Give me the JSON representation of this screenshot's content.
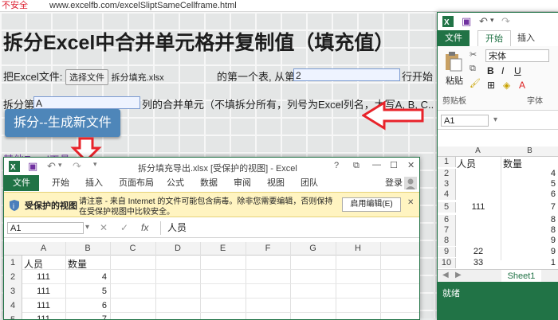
{
  "browser": {
    "security_warning": "不安全",
    "url": "www.excelfb.com/excelSliptSameCellframe.html"
  },
  "page": {
    "title": "拆分Excel中合并单元格并复制值（填充值）",
    "row1": {
      "prefix": "把Excel文件:",
      "choose_file_button": "选择文件",
      "file_name": "拆分填充.xlsx",
      "middle": "的第一个表, 从第",
      "start_row_value": "2",
      "suffix": "行开始"
    },
    "row2": {
      "prefix": "拆分第",
      "column_value": "A",
      "suffix": "列的合并单元（不填拆分所有，列号为Excel列名，大写A, B, C...."
    },
    "generate_button": "拆分--生成新文件",
    "other_tools_link": "其他Excel工具"
  },
  "colors": {
    "excel_green": "#217346",
    "button_blue": "#4e86b9",
    "arrow_red": "#e8232a"
  },
  "excel_main": {
    "title": "拆分填充导出.xlsx  [受保护的视图] - Excel",
    "title_icons": [
      "?",
      "⧉",
      "—",
      "☐",
      "✕"
    ],
    "tabs": [
      "文件",
      "开始",
      "插入",
      "页面布局",
      "公式",
      "数据",
      "审阅",
      "视图",
      "团队"
    ],
    "login": "登录",
    "protected_view": {
      "label": "受保护的视图",
      "message_line1": "请注意 - 来自 Internet 的文件可能包含病毒。除非您需要编辑，否则保持",
      "message_line2": "在受保护视图中比较安全。",
      "enable_button": "启用编辑(E)"
    },
    "name_box": "A1",
    "formula_icons": [
      "✕",
      "✓",
      "fx"
    ],
    "formula_value": "人员",
    "columns": [
      "A",
      "B",
      "C",
      "D",
      "E",
      "F",
      "G",
      "H"
    ],
    "rows": [
      {
        "num": "1",
        "a": "人员",
        "b": "数量"
      },
      {
        "num": "2",
        "a": "111",
        "b": "4"
      },
      {
        "num": "3",
        "a": "111",
        "b": "5"
      },
      {
        "num": "4",
        "a": "111",
        "b": "6"
      },
      {
        "num": "5",
        "a": "111",
        "b": "7"
      }
    ]
  },
  "excel_right": {
    "tabs": [
      "文件",
      "开始",
      "插入"
    ],
    "font_name": "宋体",
    "paste_label": "粘贴",
    "clipboard_label": "剪贴板",
    "font_label": "字体",
    "name_box": "A1",
    "columns": [
      "A",
      "B"
    ],
    "rows": [
      {
        "num": "1",
        "a": "人员",
        "b": "数量"
      },
      {
        "num": "2",
        "a": "",
        "b": "4"
      },
      {
        "num": "3",
        "a": "",
        "b": "5"
      },
      {
        "num": "4",
        "a": "",
        "b": "6"
      },
      {
        "num": "5",
        "a": "111",
        "b": "7"
      },
      {
        "num": "6",
        "a": "",
        "b": "8"
      },
      {
        "num": "7",
        "a": "",
        "b": "8"
      },
      {
        "num": "8",
        "a": "",
        "b": "9"
      },
      {
        "num": "9",
        "a": "22",
        "b": "9"
      },
      {
        "num": "10",
        "a": "33",
        "b": "1"
      }
    ],
    "sheet_tab": "Sheet1",
    "status": "就绪"
  }
}
